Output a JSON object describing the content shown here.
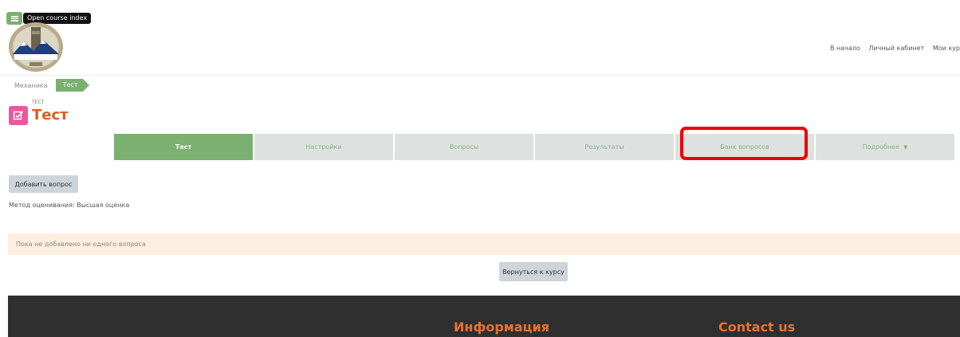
{
  "course_index": {
    "tooltip": "Open course index",
    "icon": "menu-icon"
  },
  "top_nav": {
    "items": [
      "В начало",
      "Личный кабинет",
      "Мои кур"
    ]
  },
  "breadcrumb": {
    "items": [
      "Механика",
      "Тест"
    ]
  },
  "activity": {
    "type_label": "ТЕСТ",
    "title": "Тест",
    "icon": "quiz-checkbox-icon",
    "icon_color": "#e75a9b"
  },
  "tabs": {
    "items": [
      {
        "label": "Тест",
        "active": true
      },
      {
        "label": "Настройки"
      },
      {
        "label": "Вопросы"
      },
      {
        "label": "Результаты"
      },
      {
        "label": "Банк вопросов",
        "highlighted": true
      },
      {
        "label": "Подробнее",
        "dropdown": true
      }
    ]
  },
  "content": {
    "add_question_label": "Добавить вопрос",
    "grading_method": "Метод оценивания: Высшая оценка",
    "notice": "Пока не добавлено ни одного вопроса",
    "back_label": "Вернуться к курсу"
  },
  "footer": {
    "info_title": "Информация",
    "contact_title": "Contact us"
  },
  "colors": {
    "accent_green": "#7cb071",
    "title_orange": "#e3591f",
    "footer_bg": "#2f2f2f",
    "highlight_red": "#ee0000"
  }
}
